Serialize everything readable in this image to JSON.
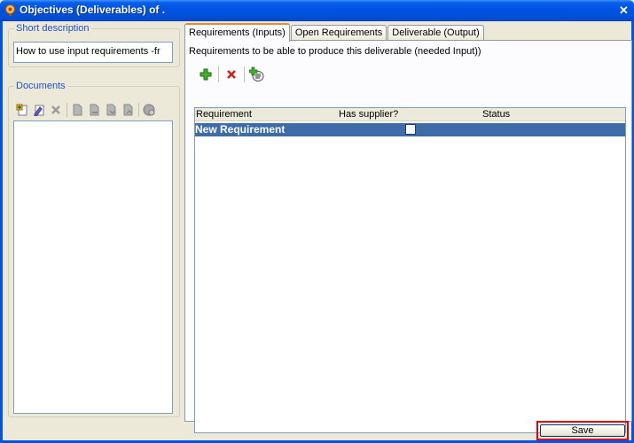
{
  "window": {
    "title": "Objectives (Deliverables) of  .",
    "close_glyph": "✕"
  },
  "left": {
    "short_description": {
      "legend": "Short description",
      "value": "How to use input requirements -fr"
    },
    "documents": {
      "legend": "Documents",
      "toolbar_icons": [
        "add-document-icon",
        "edit-document-icon",
        "delete-icon",
        "copy-document-icon",
        "paste-document-icon",
        "import-document-icon",
        "export-document-icon",
        "refresh-icon"
      ]
    }
  },
  "tabs": [
    {
      "label": "Requirements (Inputs)",
      "active": true
    },
    {
      "label": "Open Requirements",
      "active": false
    },
    {
      "label": "Deliverable (Output)",
      "active": false
    }
  ],
  "requirements": {
    "caption": "Requirements to be able to produce this deliverable (needed Input))",
    "toolbar_icons": [
      "add-icon",
      "delete-icon",
      "add-from-list-icon"
    ],
    "columns": [
      "Requirement",
      "Has supplier?",
      "Status"
    ],
    "rows": [
      {
        "requirement": "New Requirement",
        "has_supplier": false,
        "status": ""
      }
    ],
    "selected_row_color": "#3e6ca8"
  },
  "footer": {
    "save_label": "Save",
    "highlight_color": "#e00000"
  },
  "colors": {
    "titlebar": "#0054e3",
    "window_bg": "#ece9d8",
    "legend_text": "#2150c7",
    "tab_active_accent": "#e68b2c"
  }
}
